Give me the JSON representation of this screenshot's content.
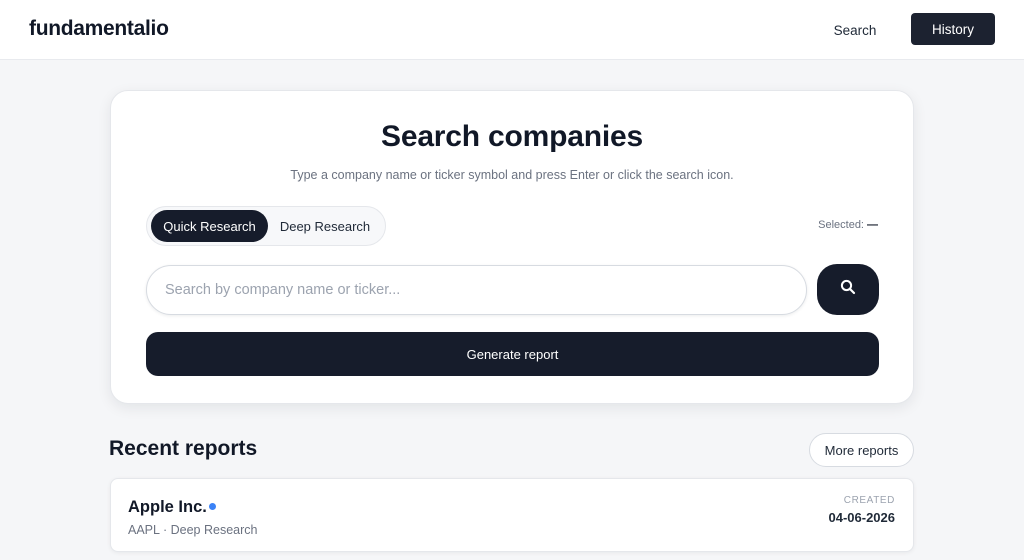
{
  "header": {
    "logo": "fundamentalio",
    "nav": {
      "search_label": "Search",
      "history_label": "History"
    }
  },
  "search_card": {
    "title": "Search companies",
    "subtitle": "Type a company name or ticker symbol and press Enter or click the search icon.",
    "modes": {
      "quick_label": "Quick Research",
      "deep_label": "Deep Research",
      "active": "Quick Research"
    },
    "selected_label": "Selected:",
    "selected_value": "—",
    "search_input": {
      "placeholder": "Search by company name or ticker...",
      "value": ""
    },
    "search_button_icon": "search-icon",
    "generate_label": "Generate report"
  },
  "recent": {
    "title": "Recent reports",
    "more_label": "More reports",
    "reports": [
      {
        "company": "Apple Inc.",
        "meta": "AAPL · Deep Research",
        "created_label": "CREATED",
        "created_date": "04-06-2026",
        "status_dot_color": "#3b82f6"
      }
    ]
  },
  "colors": {
    "primary_dark": "#161c2b",
    "accent_blue": "#3b82f6",
    "page_background": "#f5f6f8"
  }
}
